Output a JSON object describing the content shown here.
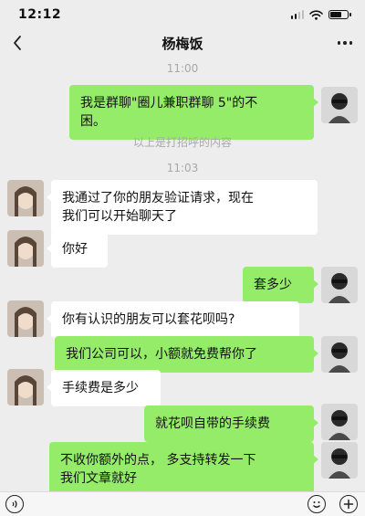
{
  "status_bar": {
    "time": "12:12"
  },
  "header": {
    "title": "杨梅饭"
  },
  "time_labels": [
    "11:00",
    "11:03"
  ],
  "system_note": "以上是打招呼的内容",
  "messages": [
    {
      "side": "out",
      "lines": [
        "我是群聊\"圈儿兼职群聊 5\"的不",
        "困。"
      ]
    },
    {
      "side": "in",
      "lines": [
        "我通过了你的朋友验证请求，现在",
        "我们可以开始聊天了"
      ]
    },
    {
      "side": "in",
      "lines": [
        "你好"
      ]
    },
    {
      "side": "out",
      "lines": [
        "套多少"
      ]
    },
    {
      "side": "in",
      "lines": [
        "你有认识的朋友可以套花呗吗?"
      ]
    },
    {
      "side": "out",
      "lines": [
        "我们公司可以，小额就免费帮你了"
      ]
    },
    {
      "side": "in",
      "lines": [
        "手续费是多少"
      ]
    },
    {
      "side": "out",
      "lines": [
        "就花呗自带的手续费"
      ]
    },
    {
      "side": "out",
      "lines": [
        "不收你额外的点， 多支持转发一下",
        "我们文章就好"
      ]
    }
  ],
  "colors": {
    "background": "#ededed",
    "outgoing_bubble": "#95ec69",
    "incoming_bubble": "#ffffff",
    "meta_text": "#a8a8a8"
  },
  "icons": [
    "back-chevron-icon",
    "more-icon",
    "voice-icon",
    "emoji-icon",
    "plus-icon",
    "signal-icon",
    "wifi-icon",
    "battery-icon"
  ]
}
